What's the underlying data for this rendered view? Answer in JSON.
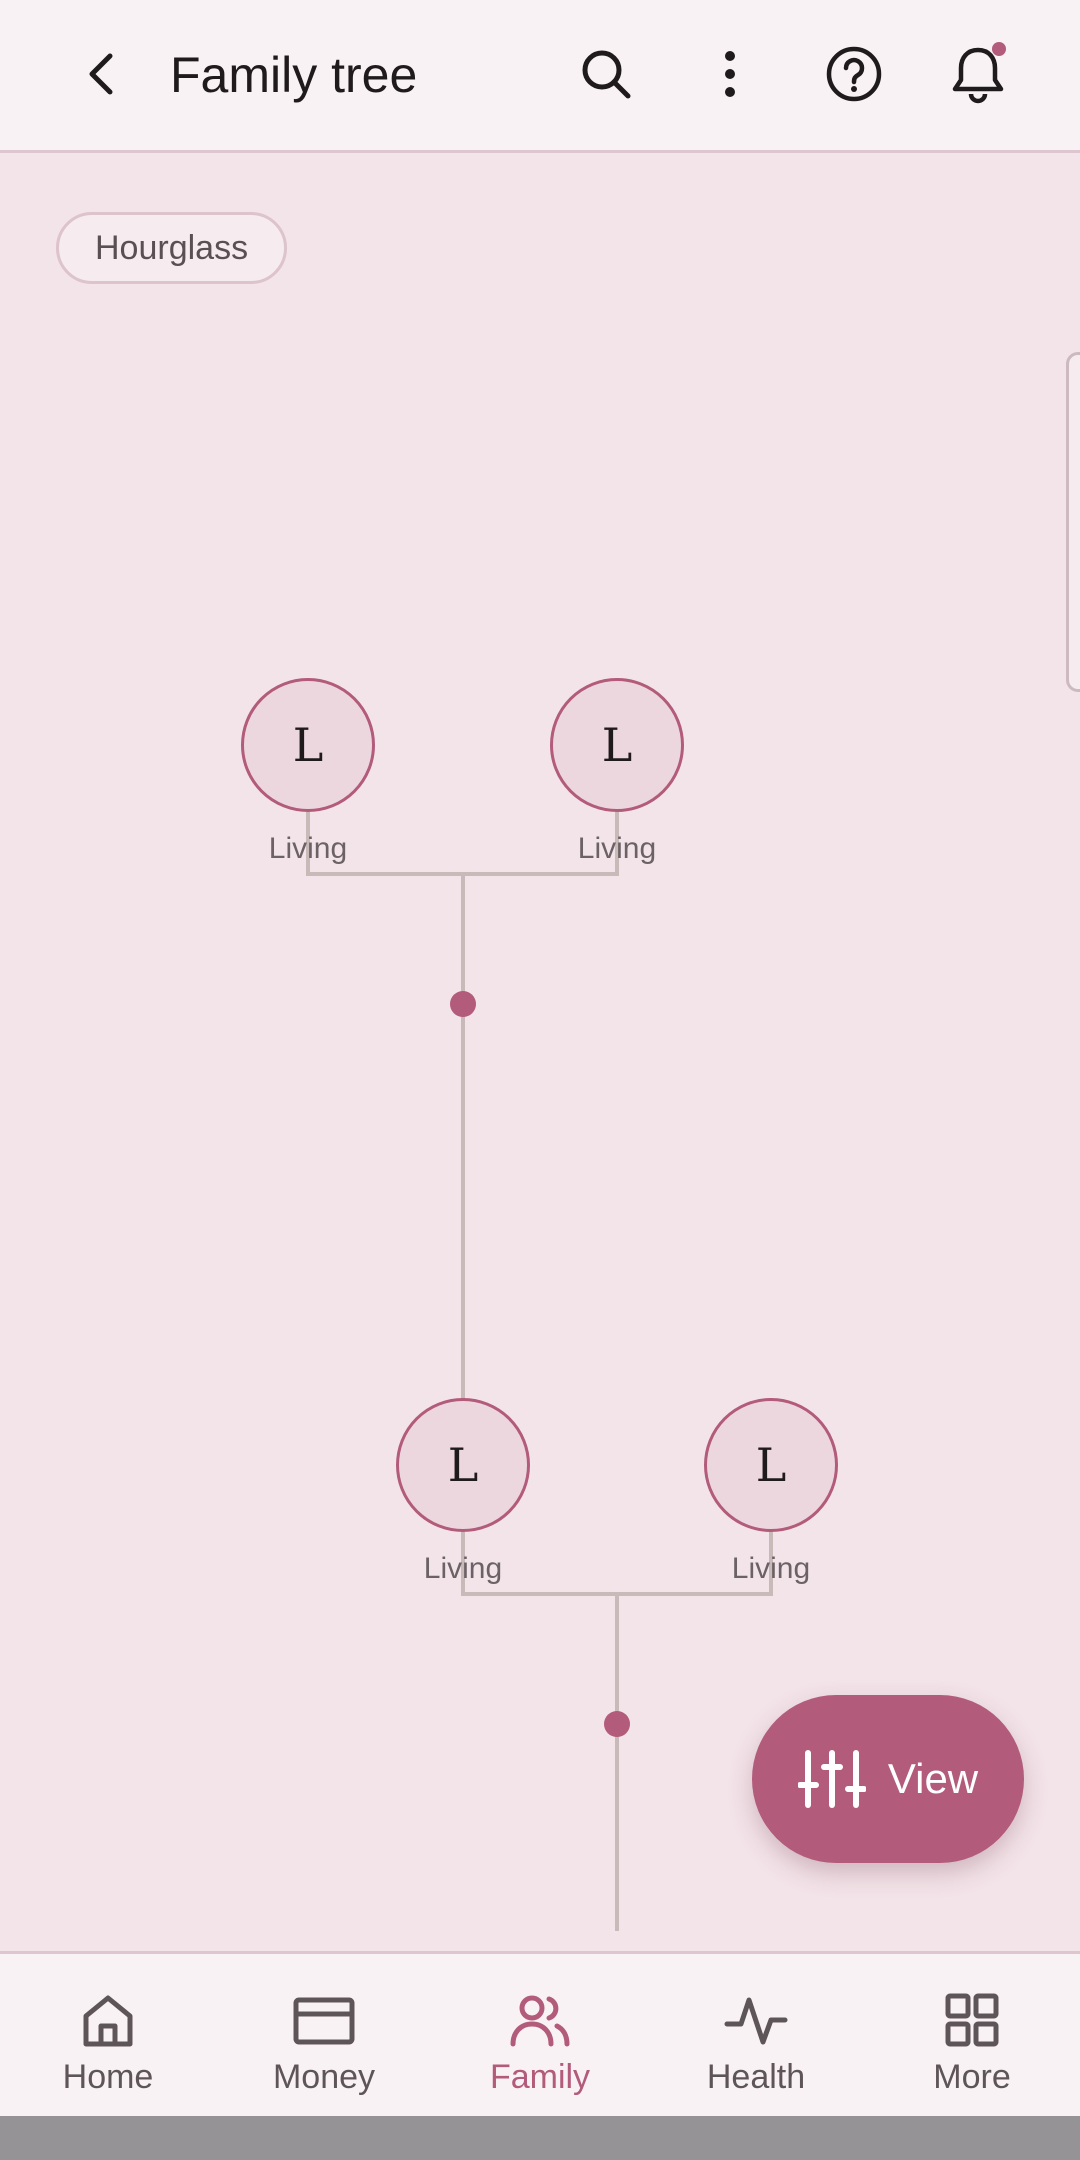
{
  "appbar": {
    "title": "Family tree",
    "back_icon": "arrow-back-icon",
    "actions": [
      "search-icon",
      "more-vert-icon",
      "help-icon",
      "notifications-icon"
    ]
  },
  "canvas": {
    "view_chip": "Hourglass",
    "nodes": [
      {
        "initial": "L",
        "label": "Living"
      },
      {
        "initial": "L",
        "label": "Living"
      },
      {
        "initial": "L",
        "label": "Living"
      },
      {
        "initial": "L",
        "label": "Living"
      }
    ]
  },
  "fab": {
    "label": "View",
    "icon": "tune-sliders-icon"
  },
  "bottom_nav": {
    "items": [
      {
        "label": "Home",
        "icon": "home-icon"
      },
      {
        "label": "Money",
        "icon": "wallet-card-icon"
      },
      {
        "label": "Family",
        "icon": "people-icon",
        "active": true
      },
      {
        "label": "Health",
        "icon": "pulse-icon"
      },
      {
        "label": "More",
        "icon": "grid-icon"
      }
    ]
  },
  "colors": {
    "accent": "#b25b7a",
    "background": "#f3e4e9",
    "surface": "#f9f2f4",
    "line": "#c8bab9"
  }
}
